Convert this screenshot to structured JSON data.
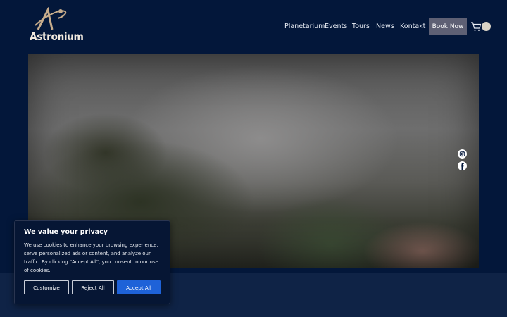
{
  "brand": {
    "name": "Astronium"
  },
  "nav": {
    "items": [
      "Planetarium",
      "Events",
      "Tours",
      "News",
      "Kontakt"
    ],
    "book_label": "Book Now"
  },
  "cookie": {
    "title": "We value your privacy",
    "text": "We use cookies to enhance your browsing experience, serve personalized ads or content, and analyze our traffic. By clicking \"Accept All\", you consent to our use of cookies.",
    "customize_label": "Customize",
    "reject_label": "Reject All",
    "accept_label": "Accept All"
  },
  "colors": {
    "background": "#03173a",
    "accent": "#1e62d8",
    "book_button": "#5e6074",
    "logo": "#c8ad8c"
  },
  "icons": [
    "cart-icon",
    "instagram-icon",
    "facebook-icon"
  ]
}
